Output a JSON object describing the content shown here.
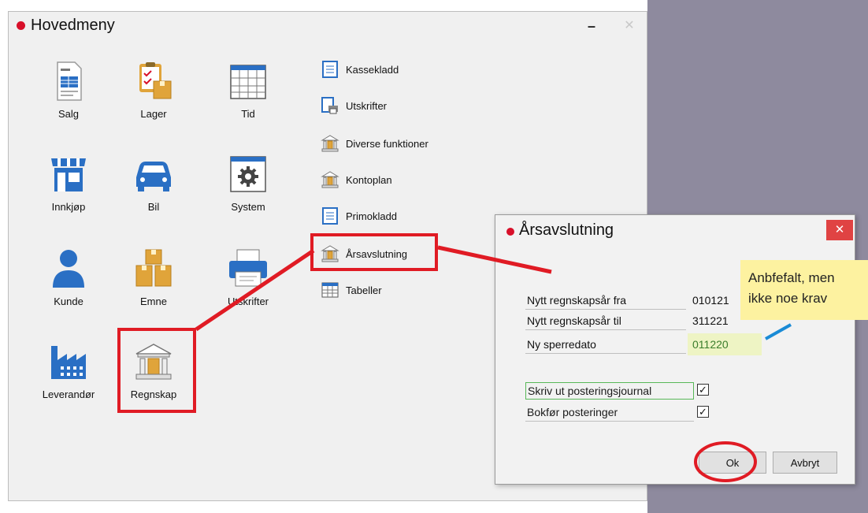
{
  "colors": {
    "accent_red": "#e01b24",
    "title_dot": "#d8102a",
    "icon_blue": "#2a6fc4",
    "icon_gold": "#e0a43a",
    "callout_bg": "#fdf2a0",
    "hilite_field": "#eef4c4"
  },
  "main_window": {
    "title": "Hovedmeny",
    "minimize": "–",
    "close": "✕",
    "tiles": [
      {
        "label": "Salg",
        "icon": "document-icon"
      },
      {
        "label": "Lager",
        "icon": "clipboard-boxes-icon"
      },
      {
        "label": "Tid",
        "icon": "calendar-icon"
      },
      {
        "label": "Innkjøp",
        "icon": "store-icon"
      },
      {
        "label": "Bil",
        "icon": "car-icon"
      },
      {
        "label": "System",
        "icon": "gear-icon"
      },
      {
        "label": "Kunde",
        "icon": "person-icon"
      },
      {
        "label": "Emne",
        "icon": "boxes-icon"
      },
      {
        "label": "Utskrifter",
        "icon": "printer-icon"
      },
      {
        "label": "Leverandør",
        "icon": "factory-icon"
      },
      {
        "label": "Regnskap",
        "icon": "bank-icon"
      }
    ],
    "list": [
      {
        "label": "Kassekladd",
        "icon": "ledger-icon"
      },
      {
        "label": "Utskrifter",
        "icon": "print-list-icon"
      },
      {
        "label": "Diverse funktioner",
        "icon": "bank-icon"
      },
      {
        "label": "Kontoplan",
        "icon": "bank-icon"
      },
      {
        "label": "Primokladd",
        "icon": "ledger-icon"
      },
      {
        "label": "Årsavslutning",
        "icon": "bank-icon"
      },
      {
        "label": "Tabeller",
        "icon": "table-icon"
      }
    ]
  },
  "dialog": {
    "title": "Årsavslutning",
    "close": "✕",
    "fields": [
      {
        "label": "Nytt regnskapsår fra",
        "value": "010121"
      },
      {
        "label": "Nytt regnskapsår til",
        "value": "311221"
      },
      {
        "label": "Ny sperredato",
        "value": "011220"
      }
    ],
    "checks": [
      {
        "label": "Skriv ut posteringsjournal",
        "checked": true
      },
      {
        "label": "Bokfør posteringer",
        "checked": true
      }
    ],
    "ok_label": "Ok",
    "cancel_label": "Avbryt"
  },
  "callout": {
    "line1": "Anbfefalt, men",
    "line2": "ikke noe krav"
  }
}
